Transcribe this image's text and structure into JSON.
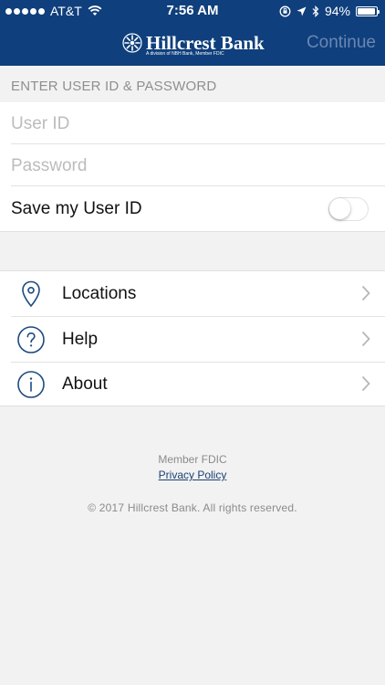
{
  "status_bar": {
    "carrier": "AT&T",
    "time": "7:56 AM",
    "battery": "94%",
    "battery_level": 0.94
  },
  "header": {
    "logo_text": "Hillcrest Bank",
    "logo_subtitle": "A division of NBH Bank, Member FDIC",
    "continue_label": "Continue",
    "background_color": "#0f3f7c"
  },
  "login": {
    "section_title": "ENTER USER ID & PASSWORD",
    "user_id_placeholder": "User ID",
    "password_placeholder": "Password",
    "save_label": "Save my User ID",
    "save_toggle_on": false
  },
  "menu": {
    "items": [
      {
        "label": "Locations",
        "icon": "location-pin-icon"
      },
      {
        "label": "Help",
        "icon": "question-circle-icon"
      },
      {
        "label": "About",
        "icon": "info-circle-icon"
      }
    ]
  },
  "footer": {
    "member_fdic": "Member FDIC",
    "privacy_policy": "Privacy Policy",
    "copyright": "© 2017 Hillcrest Bank. All rights reserved."
  }
}
